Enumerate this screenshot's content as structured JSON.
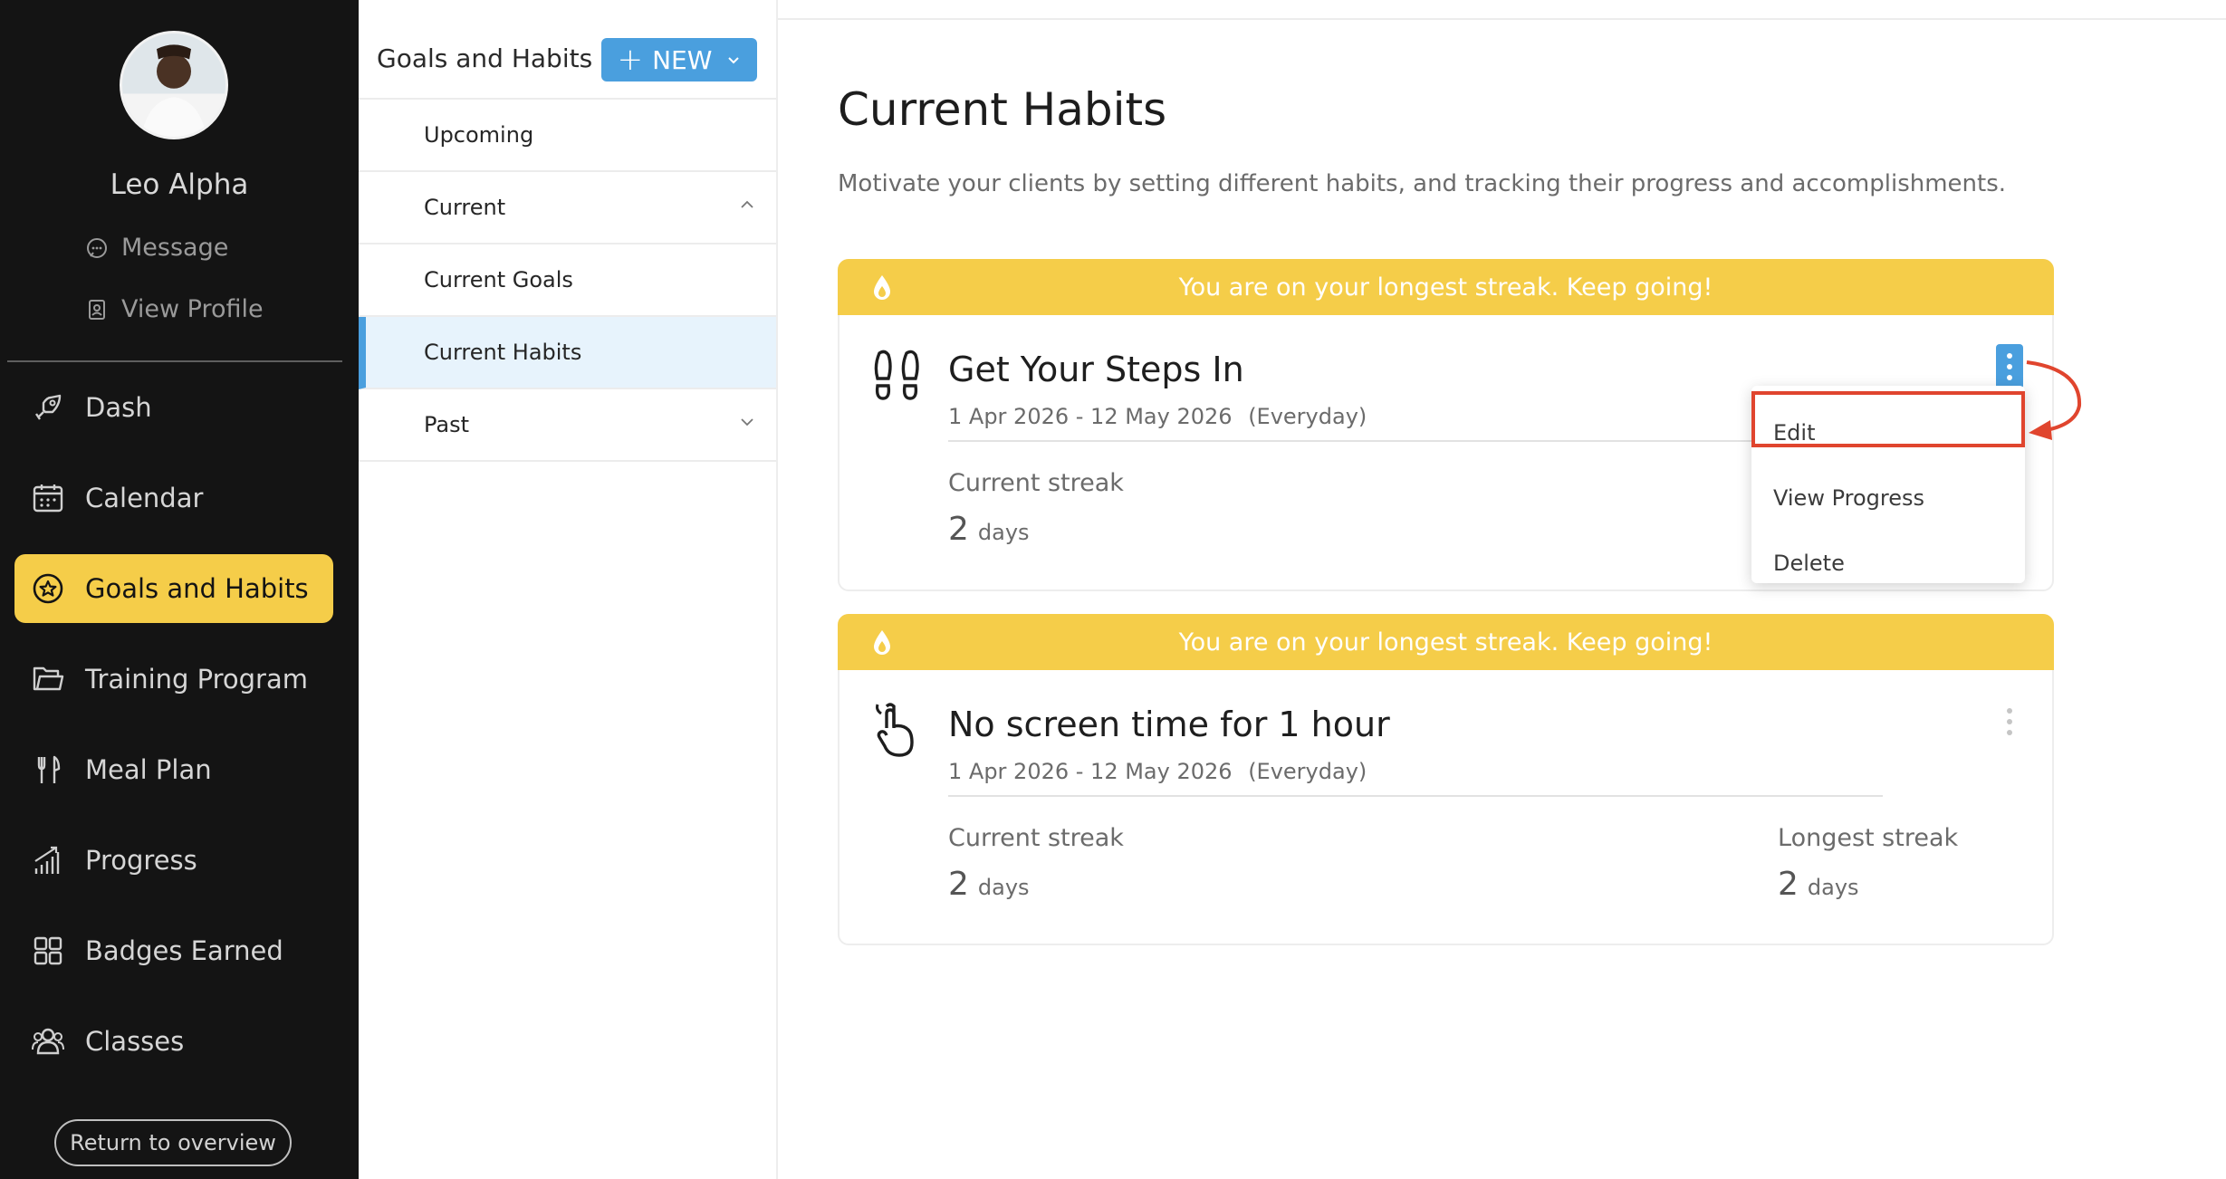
{
  "sidebar": {
    "user_name": "Leo Alpha",
    "message_label": "Message",
    "view_profile_label": "View Profile",
    "items": [
      {
        "label": "Dash",
        "icon": "rocket-icon"
      },
      {
        "label": "Calendar",
        "icon": "calendar-icon"
      },
      {
        "label": "Goals and Habits",
        "icon": "goal-star-icon",
        "active": true
      },
      {
        "label": "Training Program",
        "icon": "folder-icon"
      },
      {
        "label": "Meal Plan",
        "icon": "fork-knife-icon"
      },
      {
        "label": "Progress",
        "icon": "bar-chart-icon"
      },
      {
        "label": "Badges Earned",
        "icon": "grid-icon"
      },
      {
        "label": "Classes",
        "icon": "people-icon"
      }
    ],
    "return_label": "Return to overview",
    "active_color": "#f5cd49"
  },
  "subnav": {
    "title": "Goals and Habits",
    "new_button_label": "NEW",
    "items": [
      {
        "label": "Upcoming"
      },
      {
        "label": "Current"
      },
      {
        "label": "Current Goals"
      },
      {
        "label": "Current Habits",
        "selected": true
      },
      {
        "label": "Past"
      }
    ]
  },
  "main": {
    "title": "Current Habits",
    "description": "Motivate your clients by setting different habits, and tracking their progress and accomplishments.",
    "habits": [
      {
        "banner": "You are on your longest streak. Keep going!",
        "icon": "footprints-icon",
        "title": "Get Your Steps In",
        "dates": "1 Apr 2026 - 12 May 2026",
        "frequency": "(Everyday)",
        "current_streak_label": "Current streak",
        "current_streak_value": "2",
        "current_streak_unit": "days",
        "menu_open": true
      },
      {
        "banner": "You are on your longest streak. Keep going!",
        "icon": "hand-tap-icon",
        "title": "No screen time for 1 hour",
        "dates": "1 Apr 2026 - 12 May 2026",
        "frequency": "(Everyday)",
        "current_streak_label": "Current streak",
        "current_streak_value": "2",
        "current_streak_unit": "days",
        "longest_streak_label": "Longest streak",
        "longest_streak_value": "2",
        "longest_streak_unit": "days"
      }
    ],
    "menu": {
      "items": [
        "Edit",
        "View Progress",
        "Delete"
      ]
    }
  },
  "colors": {
    "accent_blue": "#4a9fde",
    "banner_yellow": "#f5cd49",
    "annotation_red": "#e0452e"
  }
}
